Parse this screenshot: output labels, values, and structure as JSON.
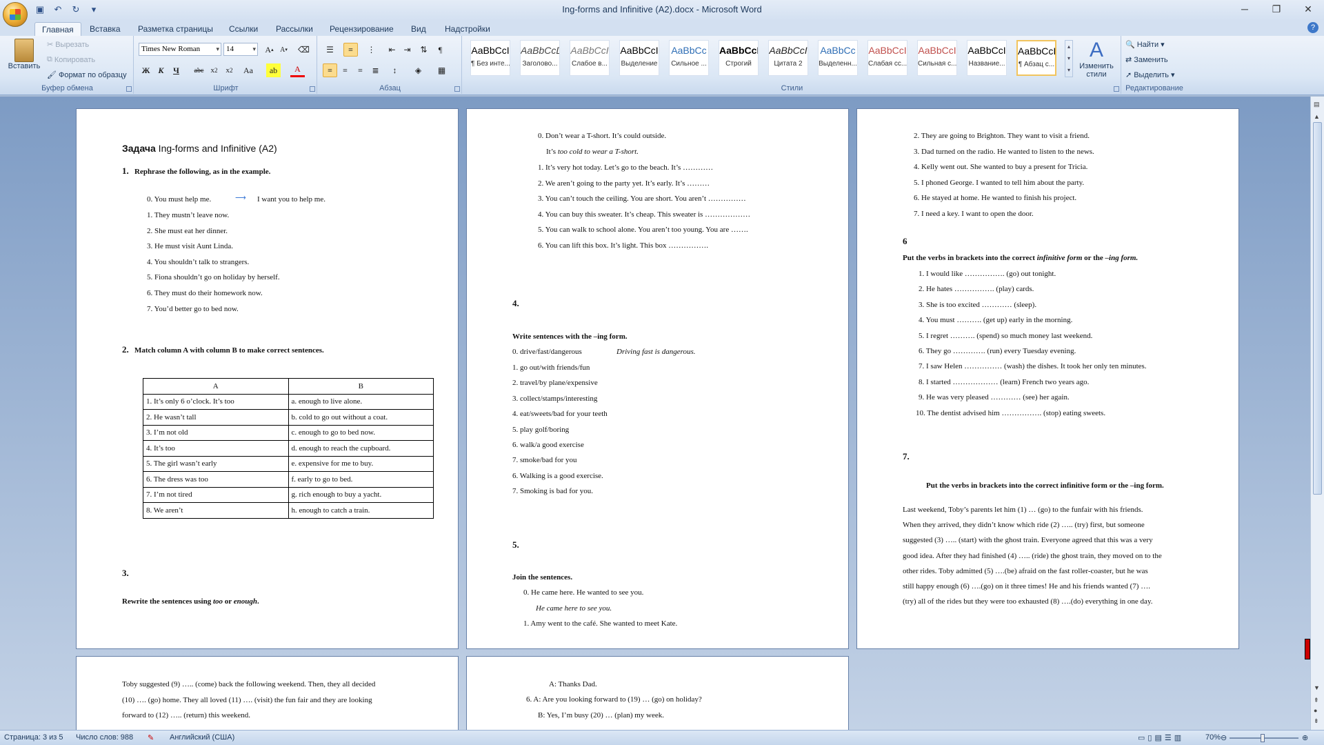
{
  "window": {
    "title": "Ing-forms and Infinitive (A2).docx - Microsoft Word"
  },
  "quick_access": [
    "save-icon",
    "undo-icon",
    "redo-icon",
    "customize-icon"
  ],
  "tabs": [
    "Главная",
    "Вставка",
    "Разметка страницы",
    "Ссылки",
    "Рассылки",
    "Рецензирование",
    "Вид",
    "Надстройки"
  ],
  "ribbon": {
    "clipboard": {
      "label": "Буфер обмена",
      "paste": "Вставить",
      "cut": "Вырезать",
      "copy": "Копировать",
      "format": "Формат по образцу"
    },
    "font": {
      "label": "Шрифт",
      "font_name": "Times New Roman",
      "font_size": "14",
      "change_case": "Aa"
    },
    "paragraph": {
      "label": "Абзац"
    },
    "styles": {
      "label": "Стили",
      "change_styles": "Изменить стили",
      "items": [
        {
          "preview": "AaBbCcI",
          "name": "¶ Без инте..."
        },
        {
          "preview": "AaBbCcDc",
          "name": "Заголово..."
        },
        {
          "preview": "AaBbCcI",
          "name": "Слабое в..."
        },
        {
          "preview": "AaBbCcI",
          "name": "Выделение"
        },
        {
          "preview": "AaBbCc",
          "name": "Сильное ..."
        },
        {
          "preview": "AaBbCcI",
          "name": "Строгий"
        },
        {
          "preview": "AaBbCcI",
          "name": "Цитата 2"
        },
        {
          "preview": "AaBbCc",
          "name": "Выделенн..."
        },
        {
          "preview": "AaBbCcI",
          "name": "Слабая сс..."
        },
        {
          "preview": "AaBbCcI",
          "name": "Сильная с..."
        },
        {
          "preview": "AaBbCcI",
          "name": "Название..."
        },
        {
          "preview": "AaBbCcI",
          "name": "¶ Абзац с..."
        }
      ]
    },
    "editing": {
      "label": "Редактирование",
      "find": "Найти",
      "replace": "Заменить",
      "select": "Выделить"
    }
  },
  "page1": {
    "title_bold": "Задача",
    "title_rest": " Ing-forms and Infinitive (A2)",
    "s1_num": "1.",
    "s1_title": "Rephrase the following, as in the example.",
    "s1_example_left": "0. You must help me.",
    "s1_example_right": "I want you to help me.",
    "s1_items": [
      "1. They mustn’t leave now.",
      "2. She must eat her dinner.",
      "3. He must visit  Aunt Linda.",
      "4. You shouldn’t talk to strangers.",
      "5. Fiona shouldn’t go on holiday by herself.",
      "6. They must do their homework now.",
      "7. You’d better go to bed now."
    ],
    "s2_num": "2.",
    "s2_title": "Match column A with column B to make correct sentences.",
    "table": {
      "head": [
        "A",
        "B"
      ],
      "rows": [
        [
          "1. It’s only 6 o’clock. It’s too",
          "a. enough to live alone."
        ],
        [
          "2. He wasn’t tall",
          "b. cold to go out without a coat."
        ],
        [
          "3. I’m not old",
          "c. enough to go  to bed now."
        ],
        [
          "4. It’s too",
          "d. enough to reach the cupboard."
        ],
        [
          "5. The girl  wasn’t early",
          "e. expensive for me to buy."
        ],
        [
          "6. The dress was too",
          "f. early to go  to bed."
        ],
        [
          "7. I’m not tired",
          "g. rich  enough to buy a yacht."
        ],
        [
          "8. We aren’t",
          "h. enough to catch a train."
        ]
      ]
    },
    "s3_num": "3.",
    "s3_pre": "Rewrite the sentences using ",
    "s3_too": "too",
    "s3_or": " or ",
    "s3_enough": "enough",
    "s3_dot": "."
  },
  "page2": {
    "example": "0. Don’t wear a T-short. It’s could outside.",
    "example_ans_a": "It’s ",
    "example_ans_b": "too cold to wear a T-short.",
    "items": [
      "1.   It’s very hot today. Let’s go to the beach. It’s …………",
      "2.   We aren’t going to the party yet. It’s early. It’s ………",
      "3.   You can’t touch the ceiling. You are short. You aren’t ……………",
      "4.   You can buy this sweater. It’s cheap. This sweater is  ………………",
      "5.   You can walk to school alone. You aren’t too young. You are …….",
      "6.   You can lift this box. It’s light.  This box ……………."
    ],
    "s4_num": "4.",
    "s4_title": "Write sentences with the –ing form.",
    "s4_example_left": "0. drive/fast/dangerous",
    "s4_example_right": "Driving fast is dangerous.",
    "s4_items": [
      "1. go out/with friends/fun",
      "2. travel/by plane/expensive",
      "3. collect/stamps/interesting",
      "4. eat/sweets/bad for your teeth",
      "5. play golf/boring",
      "6. walk/a good exercise",
      "7. smoke/bad for you",
      "6. Walking is  a good exercise.",
      "7. Smoking is  bad for you."
    ],
    "s5_num": "5.",
    "s5_title": "Join the sentences.",
    "s5_ex": "0.   He came here. He wanted to see you.",
    "s5_ex_ans": "He came here to see you.",
    "s5_item1": "1.   Amy went to the café. She wanted to meet Kate."
  },
  "page3": {
    "items": [
      "2.   They are going to Brighton.   They want to visit  a friend.",
      "3.   Dad turned on the radio. He wanted to listen to the news.",
      "4.   Kelly went out. She wanted to buy a present for Tricia.",
      "5.   I phoned George. I wanted to tell him about the party.",
      "6.   He stayed at home. He wanted to finish his project.",
      "7.   I need a key. I want to open the door."
    ],
    "s6_num": "6",
    "s6_pre": "Put the verbs in brackets into the correct ",
    "s6_inf": "infinitive form",
    "s6_mid": " or the ",
    "s6_ing": "–ing form.",
    "s6_items": [
      "1.   I would like  ……………. (go) out tonight.",
      "2.   He hates ……………. (play) cards.",
      "3.   She is too excited ………… (sleep).",
      "4.   You must ………. (get up) early in the morning.",
      "5.   I regret ………. (spend) so much money last weekend.",
      "6.   They go …………. (run) every Tuesday evening.",
      "7.   I saw Helen …………… (wash) the dishes. It took her only ten minutes.",
      "8.   I started ……………… (learn) French two years ago.",
      "9.   He was very pleased ………… (see) her again.",
      "10. The dentist advised him ……………. (stop) eating sweets."
    ],
    "s7_num": "7.",
    "s7_title": "Put the verbs in brackets into the correct infinitive form or the –ing form.",
    "s7_lines": [
      "Last weekend, Toby’s parents let him (1) … (go) to the funfair with his  friends.",
      "When they arrived, they didn’t know which ride (2) ….. (try)  first, but someone",
      "suggested (3) ….. (start) with the ghost train. Everyone agreed that this was a very",
      "good idea.  After they had finished (4) ….. (ride)  the ghost train, they moved on to the",
      "other rides.  Toby admitted (5) ….(be) afraid on the fast roller-coaster, but he was",
      "still happy enough (6) ….(go)  on it three times!  He and his friends wanted (7) ….",
      "(try) all  of the rides but they were too exhausted (8) ….(do) everything in one day."
    ]
  },
  "page4": {
    "lines": [
      "Toby suggested (9) ….. (come) back the following weekend. Then, they all decided",
      "(10) …. (go)  home. They all loved (11) …. (visit) the fun fair and they are looking",
      "forward to (12) ….. (return) this weekend."
    ]
  },
  "page5": {
    "lines": [
      "A: Thanks Dad.",
      "6.   A: Are you looking forward to (19) … (go)  on holiday?",
      "B: Yes, I’m busy (20) … (plan) my week."
    ]
  },
  "status": {
    "page": "Страница: 3 из 5",
    "words": "Число слов: 988",
    "language": "Английский (США)",
    "zoom": "70%"
  }
}
